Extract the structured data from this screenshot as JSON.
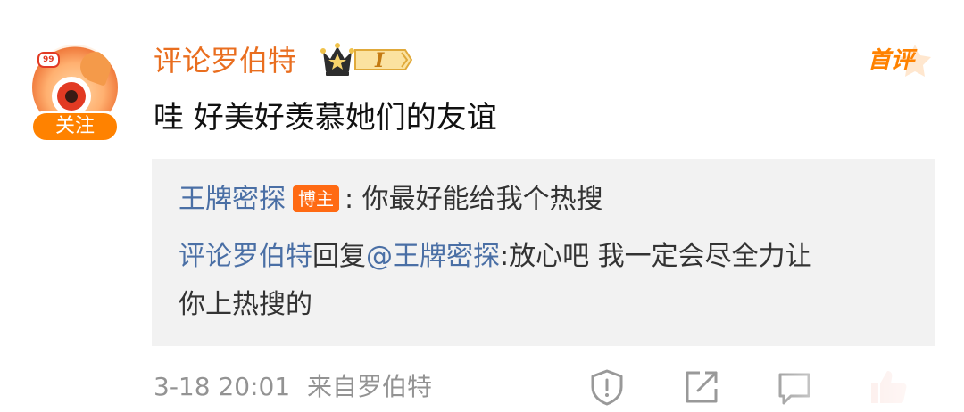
{
  "comment": {
    "author": {
      "name": "评论罗伯特",
      "avatar_badge": "99",
      "follow_label": "关注",
      "rank_badge": "I"
    },
    "tag": "首评",
    "text": "哇 好美好羡慕她们的友谊",
    "replies": [
      {
        "user": "王牌密探",
        "role_badge": "博主",
        "separator": ": ",
        "text": "你最好能给我个热搜"
      },
      {
        "user": "评论罗伯特",
        "reply_prefix": "回复",
        "mention": "@王牌密探",
        "separator": ":",
        "text_line1": "放心吧 我一定会尽全力让",
        "text_line2": "你上热搜的"
      }
    ],
    "meta": {
      "timestamp": "3-18 20:01",
      "source": "来自罗伯特"
    },
    "actions": [
      "report-icon",
      "share-icon",
      "comment-icon",
      "like-icon"
    ],
    "colors": {
      "accent": "#ff8200",
      "name": "#e96e1f",
      "link": "#4a6fa5",
      "reply_bg": "#f2f2f2"
    }
  }
}
